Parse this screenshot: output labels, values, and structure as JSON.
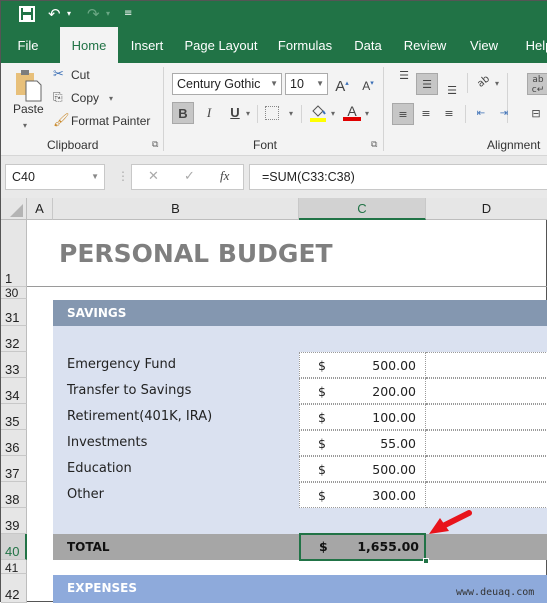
{
  "qat": {
    "save_icon": "save-icon",
    "undo_icon": "undo-icon",
    "redo_icon": "redo-icon",
    "customize_icon": "customize-qat-icon"
  },
  "tabs": [
    {
      "label": "File",
      "active": false
    },
    {
      "label": "Home",
      "active": true
    },
    {
      "label": "Insert",
      "active": false
    },
    {
      "label": "Page Layout",
      "active": false
    },
    {
      "label": "Formulas",
      "active": false
    },
    {
      "label": "Data",
      "active": false
    },
    {
      "label": "Review",
      "active": false
    },
    {
      "label": "View",
      "active": false
    },
    {
      "label": "Help",
      "active": false
    }
  ],
  "ribbon": {
    "clipboard": {
      "paste": "Paste",
      "cut": "Cut",
      "copy": "Copy",
      "format_painter": "Format Painter",
      "group_label": "Clipboard"
    },
    "font": {
      "font_name": "Century Gothic",
      "font_size": "10",
      "bold": "B",
      "italic": "I",
      "underline": "U",
      "group_label": "Font",
      "fill_color": "#ffff00",
      "font_color": "#e00000"
    },
    "alignment": {
      "group_label": "Alignment"
    }
  },
  "formula_bar": {
    "name_box": "C40",
    "cancel": "✕",
    "enter": "✓",
    "fx": "fx",
    "formula": "=SUM(C33:C38)"
  },
  "columns": [
    "A",
    "B",
    "C",
    "D"
  ],
  "selected_column": "C",
  "rows": [
    "1",
    "30",
    "31",
    "32",
    "33",
    "34",
    "35",
    "36",
    "37",
    "38",
    "39",
    "40",
    "41",
    "42"
  ],
  "selected_row": "40",
  "sheet": {
    "title": "PERSONAL BUDGET",
    "savings_header": "SAVINGS",
    "currency_symbol": "$",
    "items": [
      {
        "label": "Emergency Fund",
        "amount": "500.00"
      },
      {
        "label": "Transfer to Savings",
        "amount": "200.00"
      },
      {
        "label": "Retirement(401K, IRA)",
        "amount": "100.00"
      },
      {
        "label": "Investments",
        "amount": "55.00"
      },
      {
        "label": "Education",
        "amount": "500.00"
      },
      {
        "label": "Other",
        "amount": "300.00"
      }
    ],
    "total_label": "TOTAL",
    "total_amount": "1,655.00",
    "expenses_header": "EXPENSES"
  },
  "watermark": "www.deuaq.com",
  "colors": {
    "accent": "#217346",
    "savings_header": "#8497b0",
    "savings_body": "#dae1f0",
    "total_bar": "#a6a6a6",
    "expenses_header": "#8eaadb",
    "arrow": "#e8141b"
  }
}
